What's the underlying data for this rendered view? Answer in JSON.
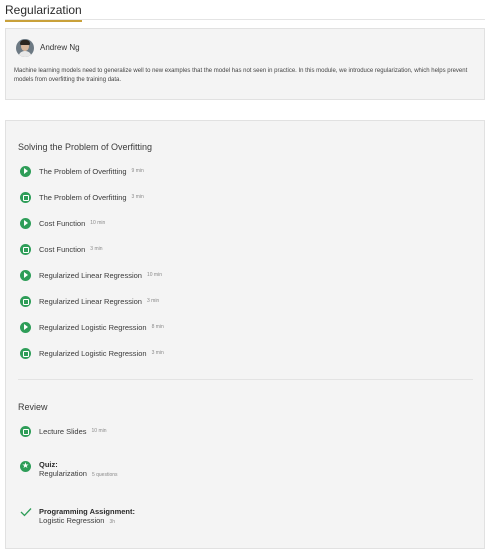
{
  "module": {
    "title": "Regularization"
  },
  "instructor": {
    "name": "Andrew Ng",
    "description": "Machine learning models need to generalize well to new examples that the model has not seen in practice. In this module, we introduce regularization, which helps prevent models from overfitting the training data."
  },
  "sections": [
    {
      "title": "Solving the Problem of Overfitting",
      "items": [
        {
          "type": "video",
          "icon": "play-icon",
          "label": "The Problem of Overfitting",
          "duration": "9 min"
        },
        {
          "type": "reading",
          "icon": "reading-icon",
          "label": "The Problem of Overfitting",
          "duration": "3 min"
        },
        {
          "type": "video",
          "icon": "play-icon",
          "label": "Cost Function",
          "duration": "10 min"
        },
        {
          "type": "reading",
          "icon": "reading-icon",
          "label": "Cost Function",
          "duration": "3 min"
        },
        {
          "type": "video",
          "icon": "play-icon",
          "label": "Regularized Linear Regression",
          "duration": "10 min"
        },
        {
          "type": "reading",
          "icon": "reading-icon",
          "label": "Regularized Linear Regression",
          "duration": "3 min"
        },
        {
          "type": "video",
          "icon": "play-icon",
          "label": "Regularized Logistic Regression",
          "duration": "8 min"
        },
        {
          "type": "reading",
          "icon": "reading-icon",
          "label": "Regularized Logistic Regression",
          "duration": "3 min"
        }
      ]
    },
    {
      "title": "Review",
      "items": [
        {
          "type": "reading",
          "icon": "reading-icon",
          "label": "Lecture Slides",
          "duration": "10 min"
        }
      ],
      "quiz": {
        "icon": "star-icon",
        "heading": "Quiz:",
        "label": "Regularization",
        "detail": "5 questions"
      },
      "assignment": {
        "icon": "checkmark-icon",
        "heading": "Programming Assignment:",
        "label": "Logistic Regression",
        "detail": "3h"
      }
    }
  ],
  "colors": {
    "accent_green": "#2e9d58",
    "tab_underline": "#c9a13a",
    "panel_bg": "#f4f4f4"
  }
}
